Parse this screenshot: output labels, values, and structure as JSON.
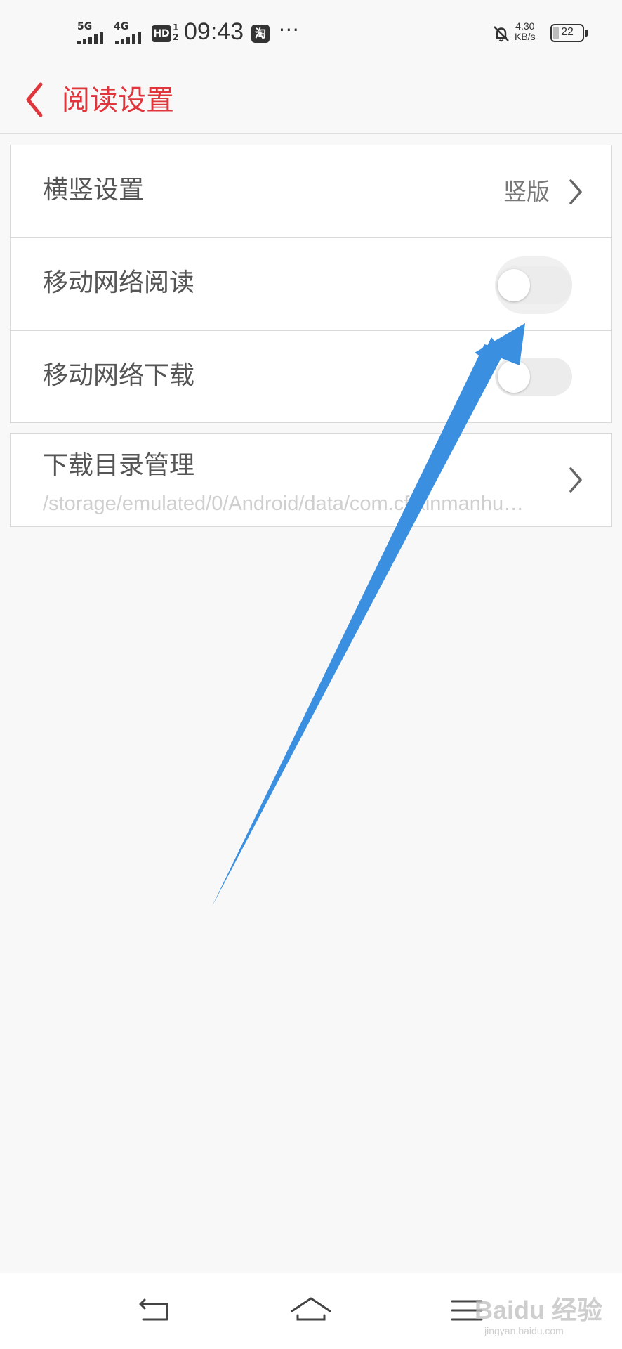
{
  "status_bar": {
    "sim1": "5G",
    "sim2": "4G",
    "hd": "HD",
    "hd_sub": "1\n2",
    "time": "09:43",
    "app_badge": "淘",
    "more": "···",
    "net_speed_value": "4.30",
    "net_speed_unit": "KB/s",
    "battery": "22",
    "icons": [
      "signal-icon",
      "signal-icon",
      "hd-voice-icon",
      "taobao-icon",
      "bell-off-icon",
      "battery-icon"
    ]
  },
  "header": {
    "title": "阅读设置",
    "accent_color": "#e0353b"
  },
  "settings": {
    "orientation": {
      "label": "横竖设置",
      "value": "竖版"
    },
    "mobile_read": {
      "label": "移动网络阅读",
      "enabled": false
    },
    "mobile_download": {
      "label": "移动网络下载",
      "enabled": false
    },
    "download_dir": {
      "label": "下载目录管理",
      "path": "/storage/emulated/0/Android/data/com.cf.xinmanhu…"
    }
  },
  "annotation": {
    "color": "#3a8fe0"
  },
  "watermark": {
    "text": "Baidu 经验",
    "sub": "jingyan.baidu.com"
  },
  "nav_bar": {
    "icons": [
      "back-icon",
      "home-icon",
      "menu-icon"
    ]
  }
}
